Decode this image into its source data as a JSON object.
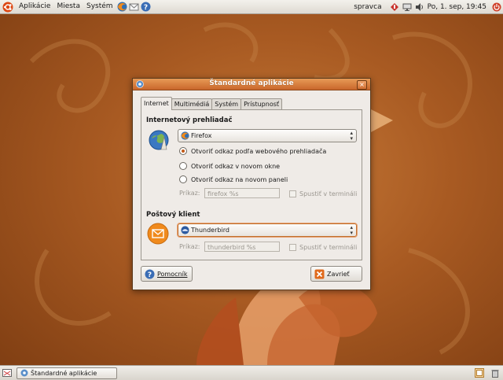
{
  "top_panel": {
    "menus": [
      "Aplikácie",
      "Miesta",
      "Systém"
    ],
    "launchers": [
      "firefox-icon",
      "mail-icon",
      "help-icon"
    ],
    "user": "spravca",
    "clock": "Po, 1. sep, 19:45"
  },
  "dialog": {
    "title": "Štandardné aplikácie",
    "tabs": [
      "Internet",
      "Multimédiá",
      "Systém",
      "Prístupnosť"
    ],
    "active_tab": 0,
    "browser": {
      "heading": "Internetový prehliadač",
      "selected": "Firefox",
      "options": [
        {
          "label": "Otvoriť odkaz podľa webového prehliadača",
          "checked": true
        },
        {
          "label": "Otvoriť odkaz v novom okne",
          "checked": false
        },
        {
          "label": "Otvoriť odkaz na novom paneli",
          "checked": false
        }
      ],
      "command_label": "Príkaz:",
      "command_value": "firefox %s",
      "terminal_label": "Spustiť v termináli"
    },
    "mail": {
      "heading": "Poštový klient",
      "selected": "Thunderbird",
      "command_label": "Príkaz:",
      "command_value": "thunderbird %s",
      "terminal_label": "Spustiť v termináli"
    },
    "help_button": "Pomocník",
    "close_button": "Zavrieť"
  },
  "bottom_panel": {
    "task": "Štandardné aplikácie"
  },
  "colors": {
    "accent": "#c9672b",
    "desktop": "#a85a22"
  }
}
